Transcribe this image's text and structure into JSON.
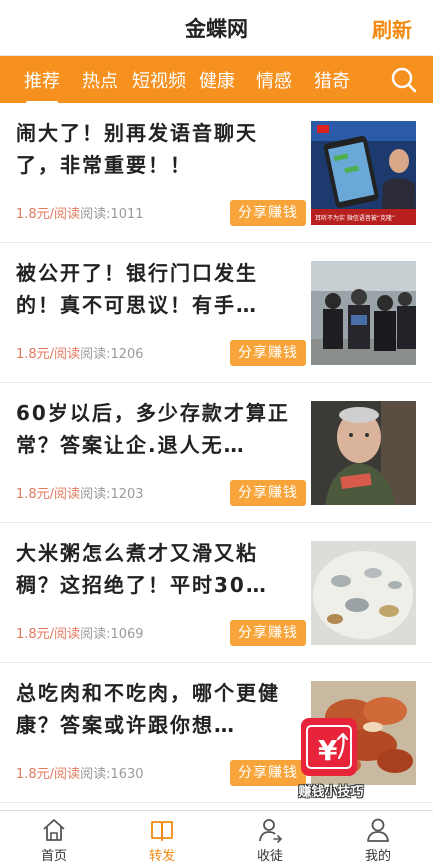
{
  "header": {
    "title": "金蝶网",
    "refresh_label": "刷新"
  },
  "tabs": [
    {
      "label": "推荐",
      "active": true
    },
    {
      "label": "热点",
      "active": false
    },
    {
      "label": "短视频",
      "active": false
    },
    {
      "label": "健康",
      "active": false
    },
    {
      "label": "情感",
      "active": false
    },
    {
      "label": "猎奇",
      "active": false
    }
  ],
  "articles": [
    {
      "title": "闹大了！别再发语音聊天了，非常重要！！",
      "price": "1.8元/阅读",
      "reads": "阅读:1011",
      "share_label": "分享赚钱",
      "thumb_caption": "耳听不为实  微信语音被“克隆”"
    },
    {
      "title": "被公开了！银行门口发生的！真不可思议！有手…",
      "price": "1.8元/阅读",
      "reads": "阅读:1206",
      "share_label": "分享赚钱"
    },
    {
      "title": "60岁以后，多少存款才算正常？答案让企.退人无…",
      "price": "1.8元/阅读",
      "reads": "阅读:1203",
      "share_label": "分享赚钱"
    },
    {
      "title": "大米粥怎么煮才又滑又粘稠？这招绝了！平时30…",
      "price": "1.8元/阅读",
      "reads": "阅读:1069",
      "share_label": "分享赚钱"
    },
    {
      "title": "总吃肉和不吃肉，哪个更健康？答案或许跟你想…",
      "price": "1.8元/阅读",
      "reads": "阅读:1630",
      "share_label": "分享赚钱"
    }
  ],
  "floating_badge": {
    "label": "赚钱小技巧",
    "symbol": "¥"
  },
  "bottom_nav": [
    {
      "label": "首页",
      "icon": "home-icon",
      "active": false
    },
    {
      "label": "转发",
      "icon": "book-icon",
      "active": true
    },
    {
      "label": "收徒",
      "icon": "add-user-icon",
      "active": false
    },
    {
      "label": "我的",
      "icon": "profile-icon",
      "active": false
    }
  ],
  "colors": {
    "accent": "#f6901e",
    "share_button": "#f7a53a",
    "price": "#e07a5f",
    "badge": "#e8243a"
  }
}
